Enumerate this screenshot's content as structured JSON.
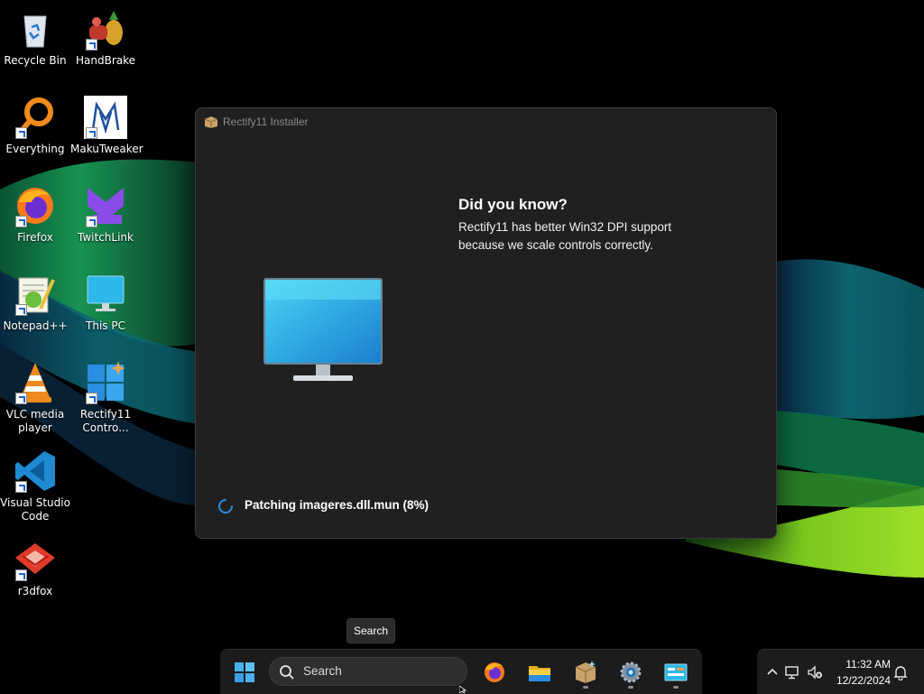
{
  "desktop": {
    "icons": [
      {
        "label": "Recycle Bin",
        "icon": "recycle-bin-icon"
      },
      {
        "label": "HandBrake",
        "icon": "handbrake-icon"
      },
      {
        "label": "Everything",
        "icon": "everything-icon"
      },
      {
        "label": "MakuTweaker",
        "icon": "makutweaker-icon"
      },
      {
        "label": "Firefox",
        "icon": "firefox-icon"
      },
      {
        "label": "TwitchLink",
        "icon": "twitchlink-icon"
      },
      {
        "label": "Notepad++",
        "icon": "notepad-plus-plus-icon"
      },
      {
        "label": "This PC",
        "icon": "this-pc-icon"
      },
      {
        "label": "VLC media player",
        "icon": "vlc-icon"
      },
      {
        "label": "Rectify11 Contro...",
        "icon": "rectify11-control-icon"
      },
      {
        "label": "Visual Studio Code",
        "icon": "vscode-icon"
      },
      {
        "label": "r3dfox",
        "icon": "r3dfox-icon"
      }
    ]
  },
  "installer": {
    "title": "Rectify11 Installer",
    "tip_heading": "Did you know?",
    "tip_body": "Rectify11 has better Win32 DPI support because we scale controls correctly.",
    "status": "Patching imageres.dll.mun (8%)",
    "progress_percent": 8
  },
  "tooltip": {
    "text": "Search"
  },
  "taskbar": {
    "search_placeholder": "Search",
    "pinned": [
      "start-icon",
      "firefox-icon",
      "file-explorer-icon",
      "installer-icon",
      "settings-icon",
      "control-panel-icon"
    ]
  },
  "tray": {
    "time": "11:32 AM",
    "date": "12/22/2024"
  },
  "colors": {
    "accent": "#0078d4",
    "window_bg": "#202020",
    "taskbar_bg": "#1c1c1c"
  }
}
